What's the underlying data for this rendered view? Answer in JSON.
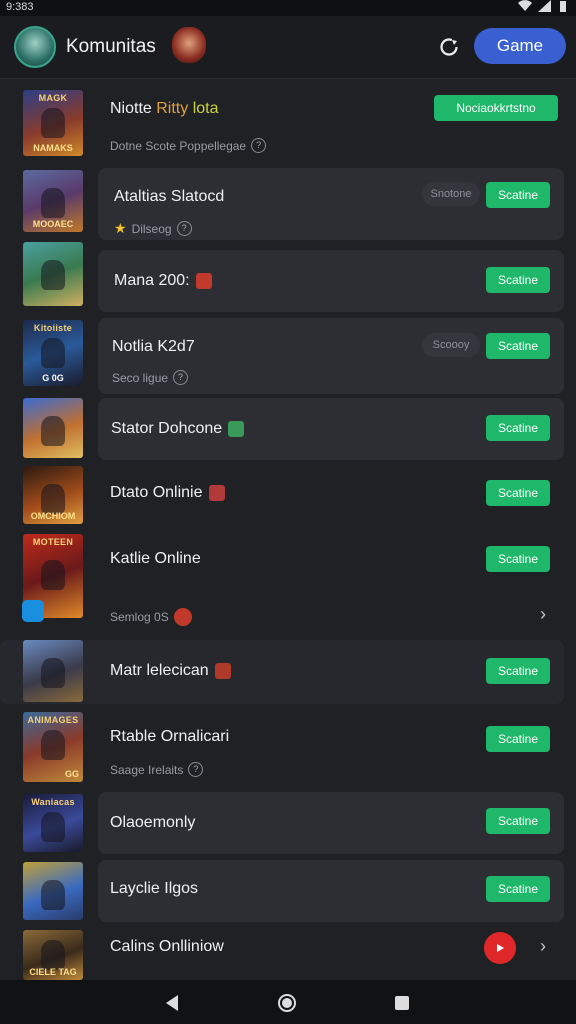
{
  "status": {
    "time": "9:383"
  },
  "header": {
    "title": "Komunitas",
    "game_button": "Game"
  },
  "rows": [
    {
      "thumb_top": "MAGK",
      "thumb_bottom": "NAMAKS",
      "title": "Niotte ",
      "title_accent": "Ritty",
      "title_green": "lota",
      "subtitle": "Dotne Scote Poppellegae",
      "action": "Nociaokkrtstno"
    },
    {
      "thumb_top": "",
      "thumb_bottom": "MOOAEC",
      "title": "Ataltias Slatocd",
      "subtitle": "Dilseog",
      "ghost": "Snotone",
      "action": "Scatine"
    },
    {
      "thumb_top": "",
      "thumb_bottom": "",
      "title": "Mana 200:",
      "action": "Scatine"
    },
    {
      "thumb_top": "Kitoiiste",
      "thumb_bottom": "G   0G",
      "title": "Notlia K2d7",
      "subtitle": "Seco ligue",
      "ghost": "Scoooy",
      "action": "Scatine"
    },
    {
      "thumb_top": "",
      "thumb_bottom": "",
      "title": "Stator Dohcone",
      "action": "Scatine"
    },
    {
      "thumb_top": "",
      "thumb_bottom": "OMCHIOM",
      "title": "Dtato Onlinie",
      "action": "Scatine"
    },
    {
      "thumb_top": "MOTEEN",
      "thumb_bottom": "",
      "title": "Katlie Online",
      "subtitle": "Semlog 0S",
      "action": "Scatine"
    },
    {
      "thumb_top": "",
      "thumb_bottom": "",
      "title": "Matr lelecican",
      "action": "Scatine"
    },
    {
      "thumb_top": "ANIMAGES",
      "thumb_bottom": "GG",
      "title": "Rtable Ornalicari",
      "subtitle": "Saage Irelaits",
      "action": "Scatine"
    },
    {
      "thumb_top": "Waniacas",
      "thumb_bottom": "",
      "title": "Olaoemonly",
      "action": "Scatine"
    },
    {
      "thumb_top": "",
      "thumb_bottom": "",
      "title": "Layclie Ilgos",
      "action": "Scatine"
    },
    {
      "thumb_top": "",
      "thumb_bottom": "CIELE TAG",
      "title": "Calins Onlliniow"
    }
  ],
  "colors": {
    "accent_green": "#1fb86a",
    "accent_blue": "#3a5fd0",
    "background": "#1f2125"
  }
}
